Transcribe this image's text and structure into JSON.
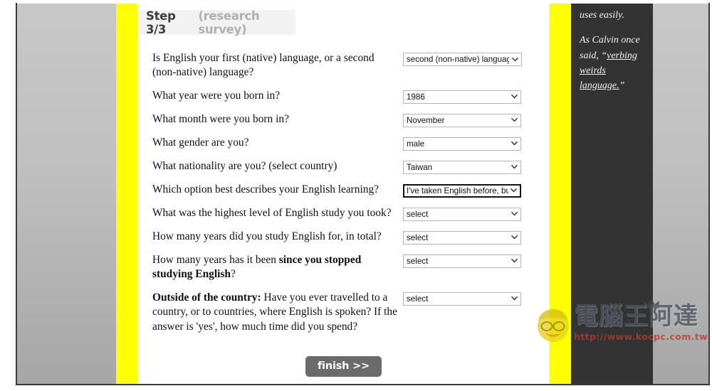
{
  "header": {
    "step_label": "Step 3/3",
    "step_sub": "(research survey)"
  },
  "form": {
    "rows": [
      {
        "question_html": "Is English your first (native) language, or a second (non-native) language?",
        "value": "second (non-native) language",
        "focused": false
      },
      {
        "question_html": "What year were you born in?",
        "value": "1986",
        "focused": false
      },
      {
        "question_html": "What month were you born in?",
        "value": "November",
        "focused": false
      },
      {
        "question_html": "What gender are you?",
        "value": "male",
        "focused": false
      },
      {
        "question_html": "What nationality are you? (select country)",
        "value": "Taiwan",
        "focused": false
      },
      {
        "question_html": "Which option best describes your English learning?",
        "value": "I've taken English before, but stopped",
        "focused": true
      },
      {
        "question_html": "What was the highest level of English study you took?",
        "value": "select",
        "focused": false
      },
      {
        "question_html": "How many years did you study English for, in total?",
        "value": "select",
        "focused": false
      },
      {
        "question_html": "How many years has it been <b>since you stopped studying English</b>?",
        "value": "select",
        "focused": false
      },
      {
        "question_html": "<b>Outside of the country:</b> Have you ever travelled to a country, or to countries, where English is spoken? If the answer is 'yes', how much time did you spend?",
        "value": "select",
        "focused": false
      }
    ],
    "finish_label": "finish >>"
  },
  "sidebar": {
    "paragraph_1": "uses easily.",
    "paragraph_2_pre": "As Calvin once said, “",
    "paragraph_2_link": "verbing weirds language.",
    "paragraph_2_post": "”"
  },
  "watermark": {
    "brand": "電腦王阿達",
    "url": "http://www.kocpc.com.tw"
  },
  "colors": {
    "accent_yellow": "#ffff00",
    "panel_dark": "#333333",
    "page_gray": "#bfbfbf",
    "button_gray": "#6b6b6b",
    "step_label": "#3d3d3d",
    "step_sub": "#b0b0b0",
    "watermark_url": "#c0392b"
  }
}
